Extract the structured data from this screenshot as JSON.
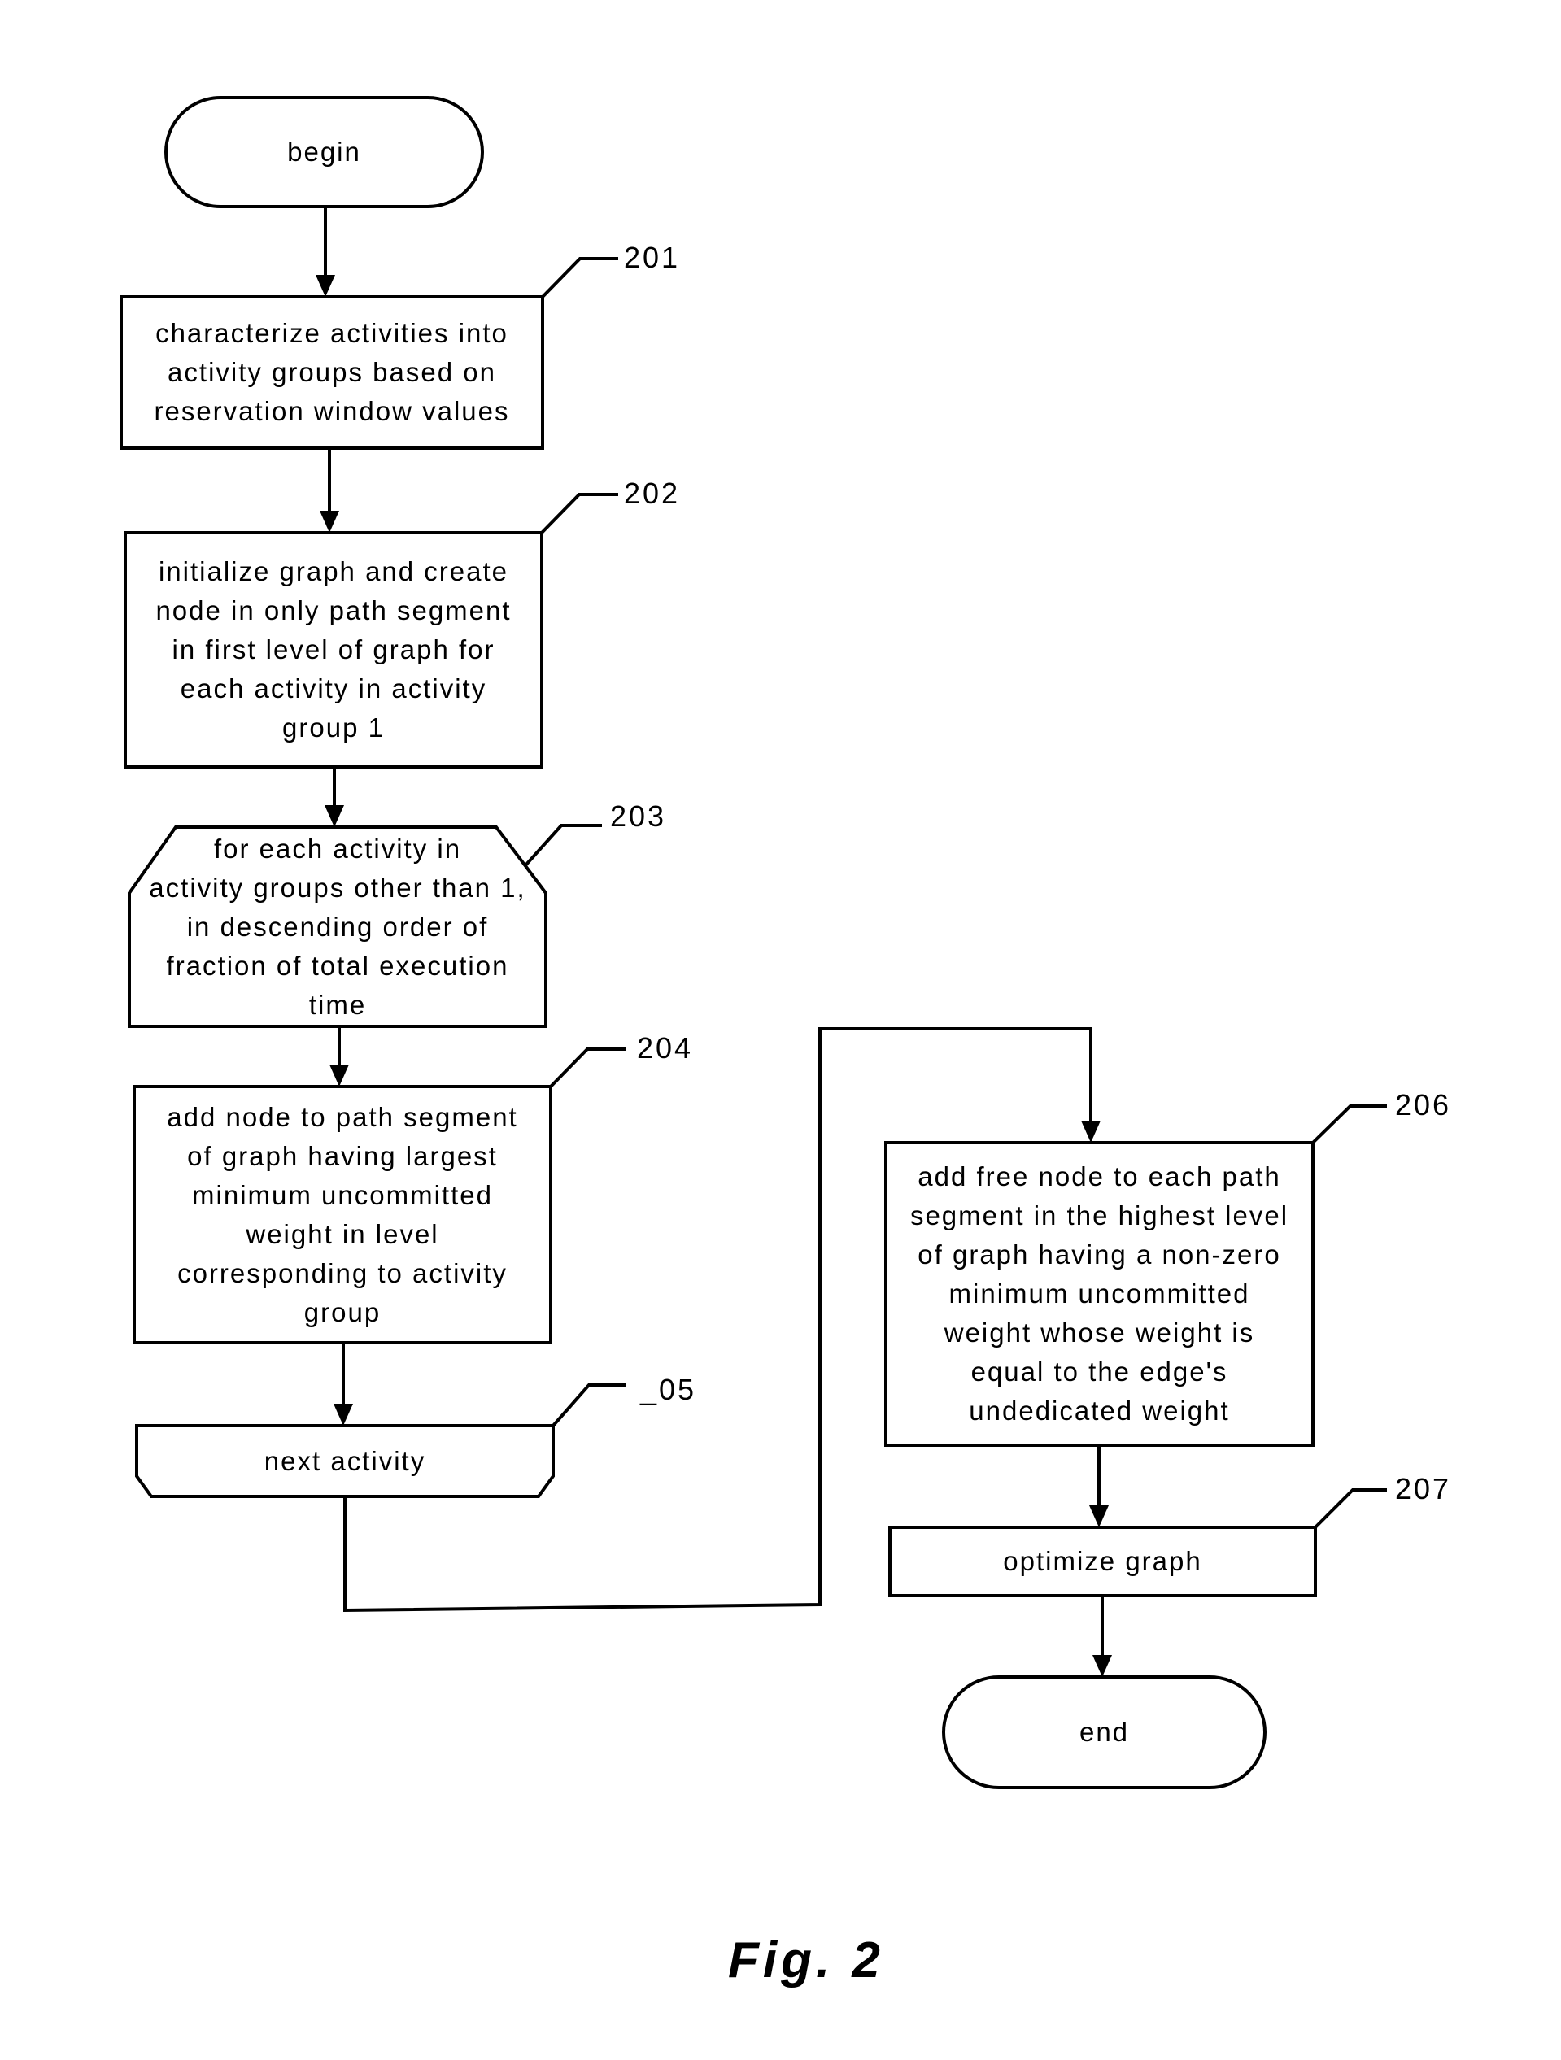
{
  "figure": {
    "caption": "Fig. 2"
  },
  "nodes": {
    "begin": {
      "type": "terminator",
      "text": "begin"
    },
    "n201": {
      "type": "process",
      "ref": "201",
      "text": "characterize activities into\nactivity groups based on\nreservation window values"
    },
    "n202": {
      "type": "process",
      "ref": "202",
      "text": "initialize graph and create\nnode in only path segment\nin first level of graph for\neach activity in activity\ngroup 1"
    },
    "n203": {
      "type": "loop-start",
      "ref": "203",
      "text": "for each activity in\nactivity groups other than 1,\nin descending order of\nfraction of total execution\ntime"
    },
    "n204": {
      "type": "process",
      "ref": "204",
      "text": "add node to path segment\nof graph having largest\nminimum uncommitted\nweight in level\ncorresponding to activity\ngroup"
    },
    "n205": {
      "type": "loop-end",
      "ref": "_05",
      "text": "next activity"
    },
    "n206": {
      "type": "process",
      "ref": "206",
      "text": "add free node to each path\nsegment in the highest level\nof graph having a non-zero\nminimum uncommitted\nweight whose weight is\nequal to the edge's\nundedicated weight"
    },
    "n207": {
      "type": "process",
      "ref": "207",
      "text": "optimize graph"
    },
    "end": {
      "type": "terminator",
      "text": "end"
    }
  },
  "edges": [
    {
      "from": "begin",
      "to": "n201"
    },
    {
      "from": "n201",
      "to": "n202"
    },
    {
      "from": "n202",
      "to": "n203"
    },
    {
      "from": "n203",
      "to": "n204"
    },
    {
      "from": "n204",
      "to": "n205"
    },
    {
      "from": "n205",
      "to": "n206"
    },
    {
      "from": "n206",
      "to": "n207"
    },
    {
      "from": "n207",
      "to": "end"
    }
  ]
}
